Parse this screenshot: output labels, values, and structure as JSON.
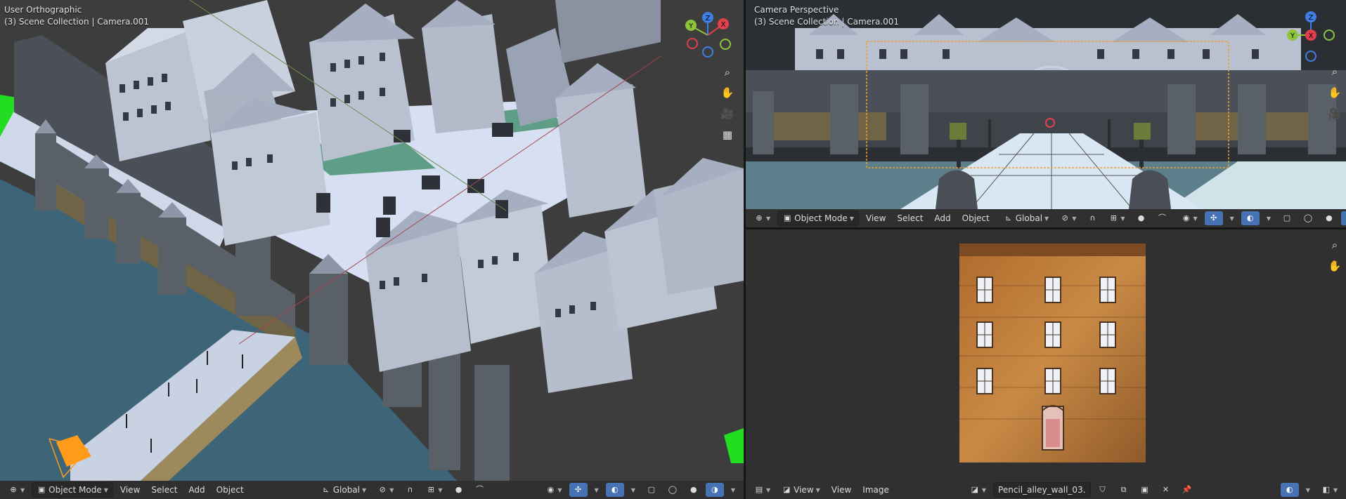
{
  "viewport_left": {
    "view_name": "User Orthographic",
    "collection": "(3) Scene Collection | Camera.001",
    "gizmo": {
      "y": "Y",
      "z": "Z",
      "x": "X"
    }
  },
  "viewport_right": {
    "view_name": "Camera Perspective",
    "collection": "(3) Scene Collection | Camera.001",
    "gizmo": {
      "z": "Z",
      "x": "X",
      "y": "Y"
    }
  },
  "header_left": {
    "mode": "Object Mode",
    "menus": [
      "View",
      "Select",
      "Add",
      "Object"
    ],
    "orientation": "Global"
  },
  "header_right": {
    "mode": "Object Mode",
    "menus": [
      "View",
      "Select",
      "Add",
      "Object"
    ],
    "orientation": "Global"
  },
  "image_editor": {
    "view_dropdown": "View",
    "menus": [
      "View",
      "Image"
    ],
    "image_name": "Pencil_alley_wall_03."
  },
  "colors": {
    "accent": "#4772b3",
    "axis_x": "#e2404f",
    "axis_y": "#8cc43c",
    "axis_z": "#3f7ee3",
    "viewport_bg": "#3d3d3d",
    "header_bg": "#303030"
  }
}
